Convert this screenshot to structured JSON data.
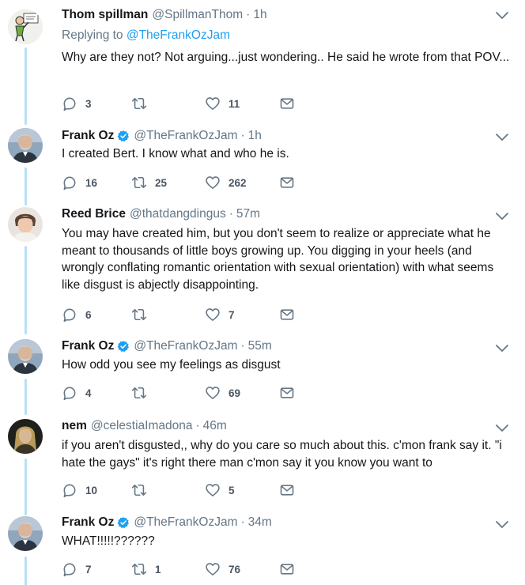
{
  "tweets": [
    {
      "name": "Thom spillman",
      "handle": "@SpillmanThom",
      "time": "1h",
      "verified": false,
      "reply_prefix": "Replying to",
      "reply_handle": "@TheFrankOzJam",
      "text": "Why are they not?  Not arguing...just wondering..  He said he wrote from that POV...",
      "replies": "3",
      "retweets": "",
      "likes": "11"
    },
    {
      "name": "Frank Oz",
      "handle": "@TheFrankOzJam",
      "time": "1h",
      "verified": true,
      "text": "I created Bert. I know what and who he is.",
      "replies": "16",
      "retweets": "25",
      "likes": "262"
    },
    {
      "name": "Reed Brice",
      "handle": "@thatdangdingus",
      "time": "57m",
      "verified": false,
      "text": "You may have created him, but you don't seem to realize or appreciate what he meant to thousands of little boys growing up. You digging in your heels (and wrongly conflating romantic orientation with sexual orientation) with what seems like disgust is abjectly disappointing.",
      "replies": "6",
      "retweets": "",
      "likes": "7"
    },
    {
      "name": "Frank Oz",
      "handle": "@TheFrankOzJam",
      "time": "55m",
      "verified": true,
      "text": "How odd you see my feelings as disgust",
      "replies": "4",
      "retweets": "",
      "likes": "69"
    },
    {
      "name": "nem",
      "handle": "@celestiaImadona",
      "time": "46m",
      "verified": false,
      "text": "if you aren't disgusted,, why do you care so much about this. c'mon frank say it. \"i hate the gays\" it's right there man c'mon say it you know you want to",
      "replies": "10",
      "retweets": "",
      "likes": "5"
    },
    {
      "name": "Frank Oz",
      "handle": "@TheFrankOzJam",
      "time": "34m",
      "verified": true,
      "text": "WHAT!!!!!??????",
      "replies": "7",
      "retweets": "1",
      "likes": "76"
    }
  ],
  "colors": {
    "accent": "#1da1f2",
    "thread_line": "#b7e0f7",
    "secondary_text": "#657786",
    "icon": "#657786"
  }
}
